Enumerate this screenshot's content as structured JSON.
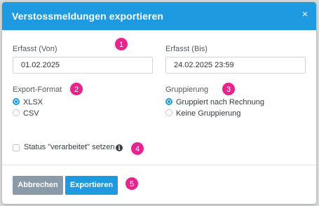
{
  "dialog": {
    "title": "Verstossmeldungen exportieren",
    "close_glyph": "×"
  },
  "fields": {
    "from_label": "Erfasst (Von)",
    "from_value": "01.02.2025",
    "to_label": "Erfasst (Bis)",
    "to_value": "24.02.2025 23:59"
  },
  "export_format": {
    "label": "Export-Format",
    "options": [
      {
        "label": "XLSX",
        "checked": true
      },
      {
        "label": "CSV",
        "checked": false
      }
    ]
  },
  "grouping": {
    "label": "Gruppierung",
    "options": [
      {
        "label": "Gruppiert nach Rechnung",
        "checked": true
      },
      {
        "label": "Keine Gruppierung",
        "checked": false
      }
    ]
  },
  "status_checkbox": {
    "label": "Status \"verarbeitet\" setzen",
    "checked": false,
    "info_glyph": "i"
  },
  "buttons": {
    "cancel": "Abbrechen",
    "export": "Exportieren"
  },
  "annotations": [
    "1",
    "2",
    "3",
    "4",
    "5"
  ],
  "colors": {
    "accent": "#1e9be0",
    "cancel_button": "#8a9aa9",
    "annotation_badge": "#e6248e"
  }
}
